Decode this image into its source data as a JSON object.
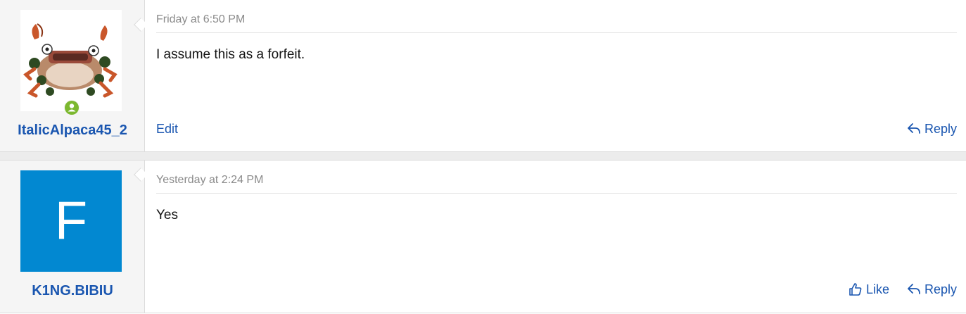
{
  "posts": [
    {
      "username": "ItalicAlpaca45_2",
      "timestamp": "Friday at 6:50 PM",
      "message": "I assume this as a forfeit.",
      "actions": {
        "edit": "Edit",
        "reply": "Reply"
      },
      "avatar": {
        "type": "image",
        "depicts": "crab creature sprite"
      },
      "online": true
    },
    {
      "username": "K1NG.BIBIU",
      "timestamp": "Yesterday at 2:24 PM",
      "message": "Yes",
      "actions": {
        "like": "Like",
        "reply": "Reply"
      },
      "avatar": {
        "type": "letter",
        "letter": "F",
        "color": "#0288d1"
      }
    }
  ],
  "colors": {
    "link": "#1a56b0",
    "online": "#7cb82f",
    "sidebar": "#f5f5f5"
  }
}
